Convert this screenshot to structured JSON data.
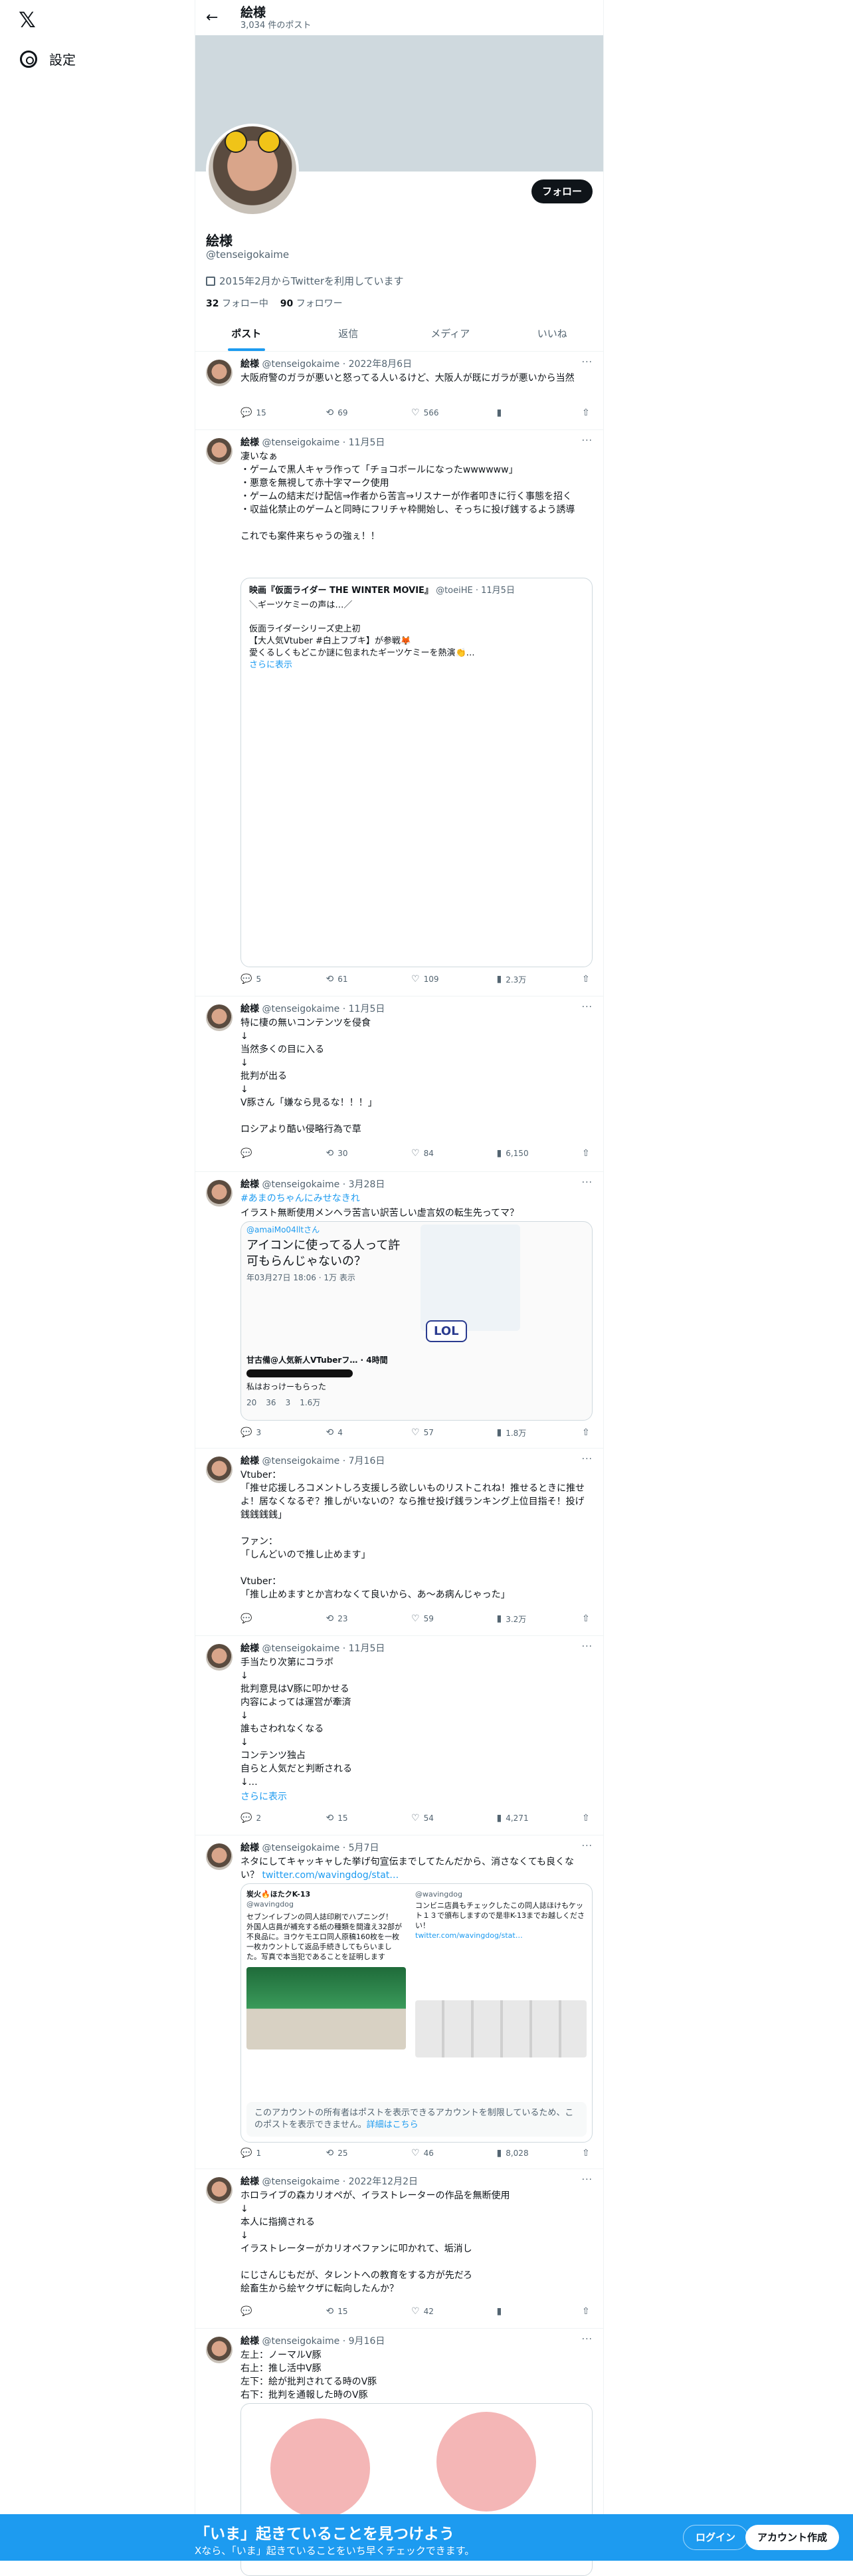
{
  "sidebar": {
    "settings": "設定"
  },
  "header": {
    "name": "絵様",
    "count": "3,034 件のポスト"
  },
  "profile": {
    "follow": "フォロー",
    "name": "絵様",
    "handle": "@tenseigokaime",
    "joined": "2015年2月からTwitterを利用しています",
    "following_count": "32",
    "following_label": "フォロー中",
    "followers_count": "90",
    "followers_label": "フォロワー"
  },
  "tabs": [
    "ポスト",
    "返信",
    "メディア",
    "いいね"
  ],
  "tweets": [
    {
      "name": "絵様",
      "handle": "@tenseigokaime",
      "date": "2022年8月6日",
      "text": "大阪府警のガラが悪いと怒ってる人いるけど、大阪人が既にガラが悪いから当然",
      "reply": "15",
      "rt": "69",
      "like": "566",
      "views": ""
    },
    {
      "name": "絵様",
      "handle": "@tenseigokaime",
      "date": "11月5日",
      "text": "凄いなぁ\n・ゲームで黒人キャラ作って「チョコボールになったwwwwww」\n・悪意を無視して赤十字マーク使用\n・ゲームの結末だけ配信⇒作者から苦言⇒リスナーが作者叩きに行く事態を招く\n・収益化禁止のゲームと同時にフリチャ枠開始し、そっちに投げ銭するよう誘導\n\nこれでも案件来ちゃうの強ぇ！！",
      "reply": "5",
      "rt": "61",
      "like": "109",
      "views": "2.3万",
      "quote": {
        "name": "映画『仮面ライダー THE WINTER MOVIE』",
        "handle": "@toeiHE",
        "date": "11月5日",
        "text": "＼ギーツケミーの声は…／\n\n仮面ライダーシリーズ史上初\n【大人気Vtuber #白上フブキ】が参戦🦊\n愛くるしくもどこか謎に包まれたギーツケミーを熱演👏…",
        "more": "さらに表示"
      }
    },
    {
      "name": "絵様",
      "handle": "@tenseigokaime",
      "date": "11月5日",
      "text": "特に棲の無いコンテンツを侵食\n↓\n当然多くの目に入る\n↓\n批判が出る\n↓\nV豚さん「嫌なら見るな！！！」\n\nロシアより酷い侵略行為で草",
      "reply": "",
      "rt": "30",
      "like": "84",
      "views": "6,150"
    },
    {
      "name": "絵様",
      "handle": "@tenseigokaime",
      "date": "3月28日",
      "text": "",
      "hashtag": "#あまのちゃんにみせなきれ",
      "text2": "イラスト無断使用メンヘラ苦言い訳苦しい虚言奴の転生先ってマ？",
      "reply": "3",
      "rt": "4",
      "like": "57",
      "views": "1.8万",
      "media": {
        "handle": "@amaiMo04lltさん",
        "title": "アイコンに使ってる人って許可もらんじゃないの？",
        "time": "年03月27日 18:06 · 1万 表示",
        "sub": "甘古備@人気新人VTuberフ… · 4時間",
        "sub2": "私はおっけーもらった",
        "s1": "20",
        "s2": "36",
        "s3": "3",
        "s4": "1.6万",
        "badge": "LOL"
      }
    },
    {
      "name": "絵様",
      "handle": "@tenseigokaime",
      "date": "7月16日",
      "text": "Vtuber：\n「推せ応援しろコメントしろ支援しろ欲しいものリストこれね！推せるときに推せよ！居なくなるぞ？推しがいないの？なら推せ投げ銭ランキング上位目指そ！投げ銭銭銭銭」\n\nファン：\n「しんどいので推し止めます」\n\nVtuber：\n「推し止めますとか言わなくて良いから、あ〜あ病んじゃった」",
      "reply": "",
      "rt": "23",
      "like": "59",
      "views": "3.2万"
    },
    {
      "name": "絵様",
      "handle": "@tenseigokaime",
      "date": "11月5日",
      "text": "手当たり次第にコラボ\n↓\n批判意見はV豚に叩かせる\n内容によっては運営が牽済\n↓\n誰もさわれなくなる\n↓\nコンテンツ独占\n自らと人気だと判断される\n↓…",
      "more": "さらに表示",
      "reply": "2",
      "rt": "15",
      "like": "54",
      "views": "4,271"
    },
    {
      "name": "絵様",
      "handle": "@tenseigokaime",
      "date": "5月7日",
      "text": "ネタにしてキャッキャした挙げ句宣伝までしてたんだから、消さなくても良くない？ ",
      "url": "twitter.com/wavingdog/stat…",
      "reply": "1",
      "rt": "25",
      "like": "46",
      "views": "8,028",
      "quote": {
        "left_name": "炭火🔥ほたクK-13",
        "left_handle": "@wavingdog",
        "left_text": "セブンイレブンの同人誌印刷でハプニング！\n外国人店員が補充する紙の種類を間違え32部が不良品に。ヨウケモエロ同人原稿160枚を一枚一枚カウントして返品手続きしてもらいました。写真で本当犯であることを証明します",
        "right_handle": "@wavingdog",
        "right_text": "コンビニ店員もチェックしたこの同人誌ほけもケット１３で頒布しますので是非K-13までお越しください！",
        "right_url": "twitter.com/wavingdog/stat…",
        "unavailable": "このアカウントの所有者はポストを表示できるアカウントを制限しているため、このポストを表示できません。",
        "detail": "詳細はこちら"
      }
    },
    {
      "name": "絵様",
      "handle": "@tenseigokaime",
      "date": "2022年12月2日",
      "text": "ホロライブの森カリオペが、イラストレーターの作品を無断使用\n↓\n本人に指摘される\n↓\nイラストレーターがカリオペファンに叩かれて、垢消し\n\nにじさんじもだが、タレントへの教育をする方が先だろ\n絵畜生から絵ヤクザに転向したんか？",
      "reply": "",
      "rt": "15",
      "like": "42",
      "views": ""
    },
    {
      "name": "絵様",
      "handle": "@tenseigokaime",
      "date": "9月16日",
      "text": "左上：ノーマルV豚\n右上：推し活中V豚\n左下：絵が批判されてる時のV豚\n右下：批判を通報した時のV豚"
    }
  ],
  "bottombar": {
    "headline": "「いま」起きていることを見つけよう",
    "sub": "Xなら、「いま」起きていることをいち早くチェックできます。",
    "login": "ログイン",
    "signup": "アカウント作成"
  }
}
